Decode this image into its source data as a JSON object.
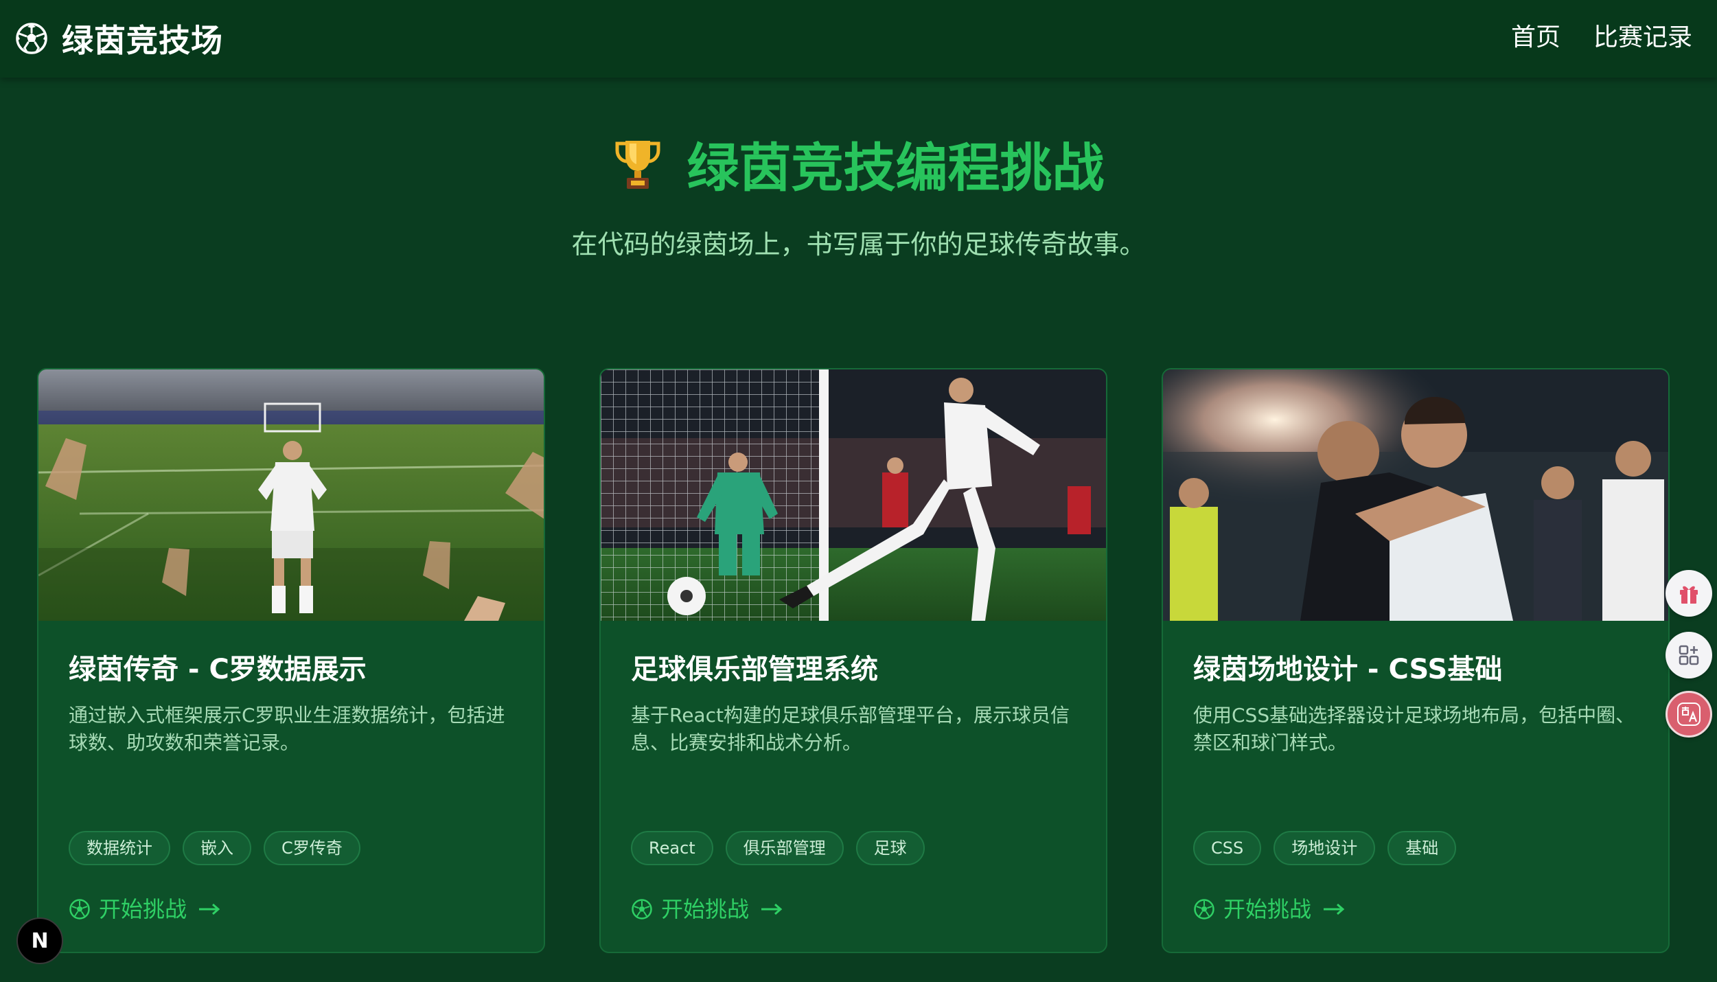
{
  "nav": {
    "brand": "绿茵竞技场",
    "links": [
      "首页",
      "比赛记录"
    ]
  },
  "hero": {
    "title": "绿茵竞技编程挑战",
    "subtitle": "在代码的绿茵场上，书写属于你的足球传奇故事。"
  },
  "cards": [
    {
      "title": "绿茵传奇 - C罗数据展示",
      "description": "通过嵌入式框架展示C罗职业生涯数据统计，包括进球数、助攻数和荣誉记录。",
      "tags": [
        "数据统计",
        "嵌入",
        "C罗传奇"
      ],
      "cta": "开始挑战"
    },
    {
      "title": "足球俱乐部管理系统",
      "description": "基于React构建的足球俱乐部管理平台，展示球员信息、比赛安排和战术分析。",
      "tags": [
        "React",
        "俱乐部管理",
        "足球"
      ],
      "cta": "开始挑战"
    },
    {
      "title": "绿茵场地设计 - CSS基础",
      "description": "使用CSS基础选择器设计足球场地布局，包括中圈、禁区和球门样式。",
      "tags": [
        "CSS",
        "场地设计",
        "基础"
      ],
      "cta": "开始挑战"
    }
  ],
  "badge": {
    "letter": "N"
  },
  "colors": {
    "page_bg": "#0a3d20",
    "nav_bg": "#07391b",
    "accent_green": "#28c45c",
    "card_bg": "#0d5129"
  },
  "icons": [
    "soccer-ball-icon",
    "trophy-icon",
    "arrow-right-icon",
    "gift-icon",
    "apps-icon",
    "translate-icon"
  ]
}
